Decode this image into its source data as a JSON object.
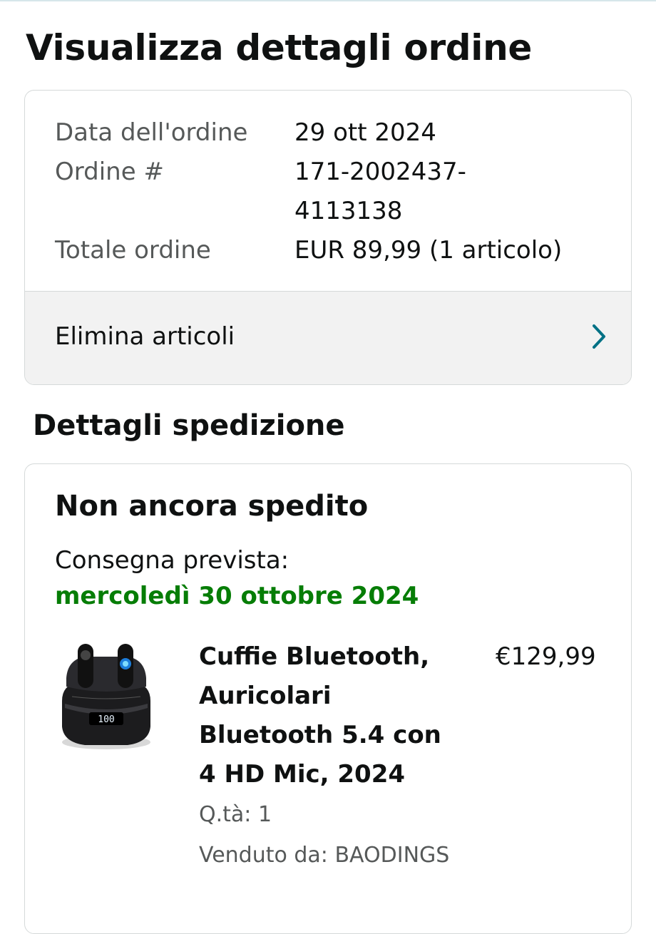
{
  "page": {
    "title": "Visualizza dettagli ordine"
  },
  "summary": {
    "order_date_label": "Data dell'ordine",
    "order_date_value": "29 ott 2024",
    "order_number_label": "Ordine #",
    "order_number_value_line1": "171-2002437-",
    "order_number_value_line2": "4113138",
    "order_total_label": "Totale ordine",
    "order_total_value": "EUR 89,99 (1 articolo)",
    "delete_items_label": "Elimina articoli",
    "delete_items_icon": "chevron-right-icon"
  },
  "shipment": {
    "section_title": "Dettagli spedizione",
    "status": "Non ancora spedito",
    "delivery_label": "Consegna prevista:",
    "delivery_date": "mercoledì 30 ottobre 2024",
    "delivery_date_color": "#067d06",
    "item": {
      "image_icon": "earbuds-product-image",
      "title": "Cuffie Bluetooth, Auricolari Bluetooth 5.4 con 4 HD Mic, 2024",
      "price": "€129,99",
      "quantity": "Q.tà: 1",
      "seller": "Venduto da: BAODINGS",
      "case_display": "100"
    }
  },
  "colors": {
    "link_accent": "#007185",
    "text": "#0f1111",
    "muted": "#565959",
    "border": "#d5d9d9"
  }
}
